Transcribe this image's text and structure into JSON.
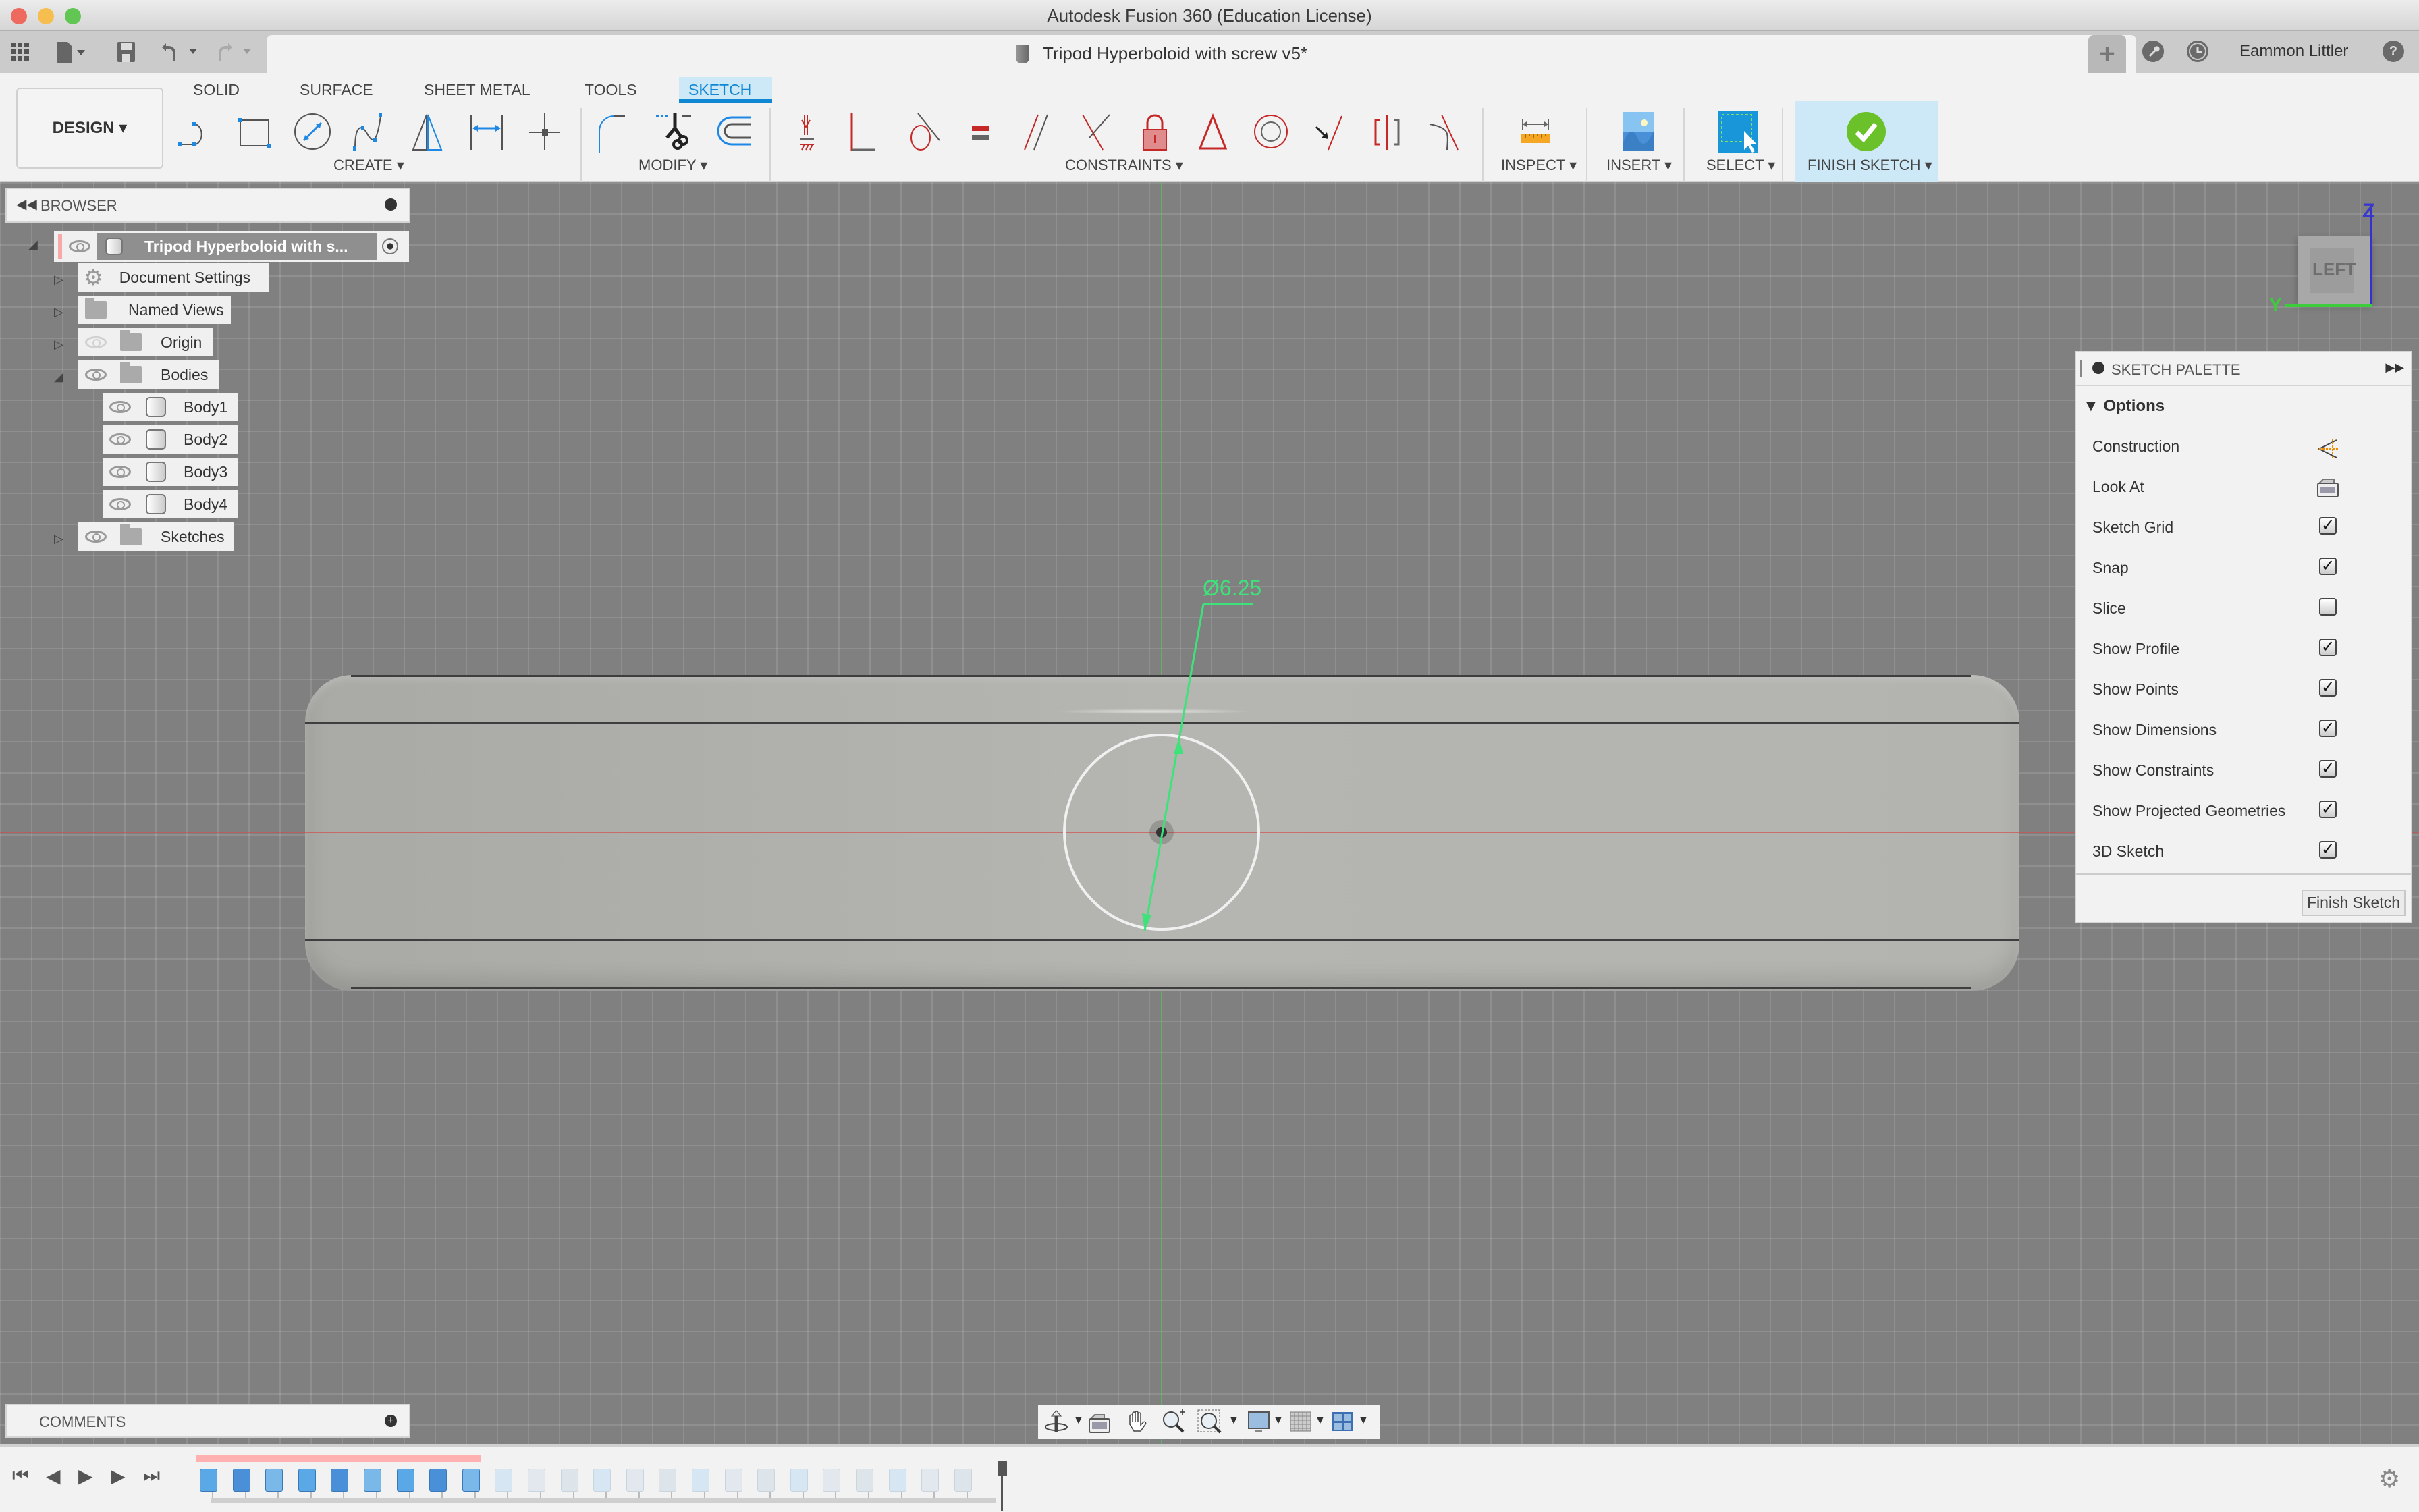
{
  "window": {
    "title": "Autodesk Fusion 360 (Education License)",
    "traffic_lights": {
      "close": "#ee6a5f",
      "minimize": "#f6be4f",
      "zoom": "#62c655"
    }
  },
  "tabbar": {
    "document_title": "Tripod Hyperboloid with screw v5*",
    "close_label": "×",
    "new_tab_label": "+",
    "user_name": "Eammon Littler",
    "help_label": "?",
    "icons": [
      "grid-apps-icon",
      "file-icon",
      "save-icon",
      "undo-icon",
      "redo-icon",
      "extensions-icon",
      "job-status-icon",
      "help-icon"
    ]
  },
  "ribbon": {
    "workspace": "DESIGN ▾",
    "tabs": [
      {
        "label": "SOLID",
        "active": false
      },
      {
        "label": "SURFACE",
        "active": false
      },
      {
        "label": "SHEET METAL",
        "active": false
      },
      {
        "label": "TOOLS",
        "active": false
      },
      {
        "label": "SKETCH",
        "active": true
      }
    ],
    "groups": {
      "create": "CREATE ▾",
      "modify": "MODIFY ▾",
      "constraints": "CONSTRAINTS ▾",
      "inspect": "INSPECT ▾",
      "insert": "INSERT ▾",
      "select": "SELECT ▾",
      "finish": "FINISH SKETCH ▾"
    },
    "accent_color": "#0f87d2",
    "active_tab_bg": "#cde8f6"
  },
  "browser": {
    "title": "BROWSER",
    "root": "Tripod Hyperboloid with s...",
    "items": [
      {
        "label": "Document Settings",
        "icon": "gear-icon",
        "caret": "▷"
      },
      {
        "label": "Named Views",
        "icon": "folder-icon",
        "caret": "▷"
      },
      {
        "label": "Origin",
        "icon": "folder-icon",
        "caret": "▷",
        "hidden": true
      },
      {
        "label": "Bodies",
        "icon": "folder-icon",
        "caret": "◢"
      },
      {
        "label": "Body1",
        "icon": "body-icon"
      },
      {
        "label": "Body2",
        "icon": "body-icon"
      },
      {
        "label": "Body3",
        "icon": "body-icon"
      },
      {
        "label": "Body4",
        "icon": "body-icon"
      },
      {
        "label": "Sketches",
        "icon": "folder-icon",
        "caret": "▷"
      }
    ]
  },
  "comments": {
    "title": "COMMENTS"
  },
  "viewcube": {
    "face": "LEFT",
    "axis_z": "Z",
    "axis_y": "Y"
  },
  "sketch": {
    "dimension": "Ø6.25",
    "dimension_color": "#3ee27a"
  },
  "palette": {
    "title": "SKETCH PALETTE",
    "section": "Options",
    "options": [
      {
        "label": "Construction",
        "type": "icon",
        "icon": "construction-icon"
      },
      {
        "label": "Look At",
        "type": "icon",
        "icon": "look-at-icon"
      },
      {
        "label": "Sketch Grid",
        "type": "checkbox",
        "checked": true
      },
      {
        "label": "Snap",
        "type": "checkbox",
        "checked": true
      },
      {
        "label": "Slice",
        "type": "checkbox",
        "checked": false
      },
      {
        "label": "Show Profile",
        "type": "checkbox",
        "checked": true
      },
      {
        "label": "Show Points",
        "type": "checkbox",
        "checked": true
      },
      {
        "label": "Show Dimensions",
        "type": "checkbox",
        "checked": true
      },
      {
        "label": "Show Constraints",
        "type": "checkbox",
        "checked": true
      },
      {
        "label": "Show Projected Geometries",
        "type": "checkbox",
        "checked": true
      },
      {
        "label": "3D Sketch",
        "type": "checkbox",
        "checked": true
      }
    ],
    "finish_button": "Finish Sketch"
  },
  "navbar": {
    "icons": [
      "orbit-icon",
      "look-at-icon",
      "pan-icon",
      "zoom-icon",
      "fit-icon",
      "display-settings-icon",
      "grid-settings-icon",
      "viewports-icon"
    ]
  },
  "timeline": {
    "controls": [
      "|◀",
      "◀",
      "▶",
      "▶|",
      "▶▶|"
    ],
    "active_feature_count": 9,
    "total_feature_count": 24
  }
}
